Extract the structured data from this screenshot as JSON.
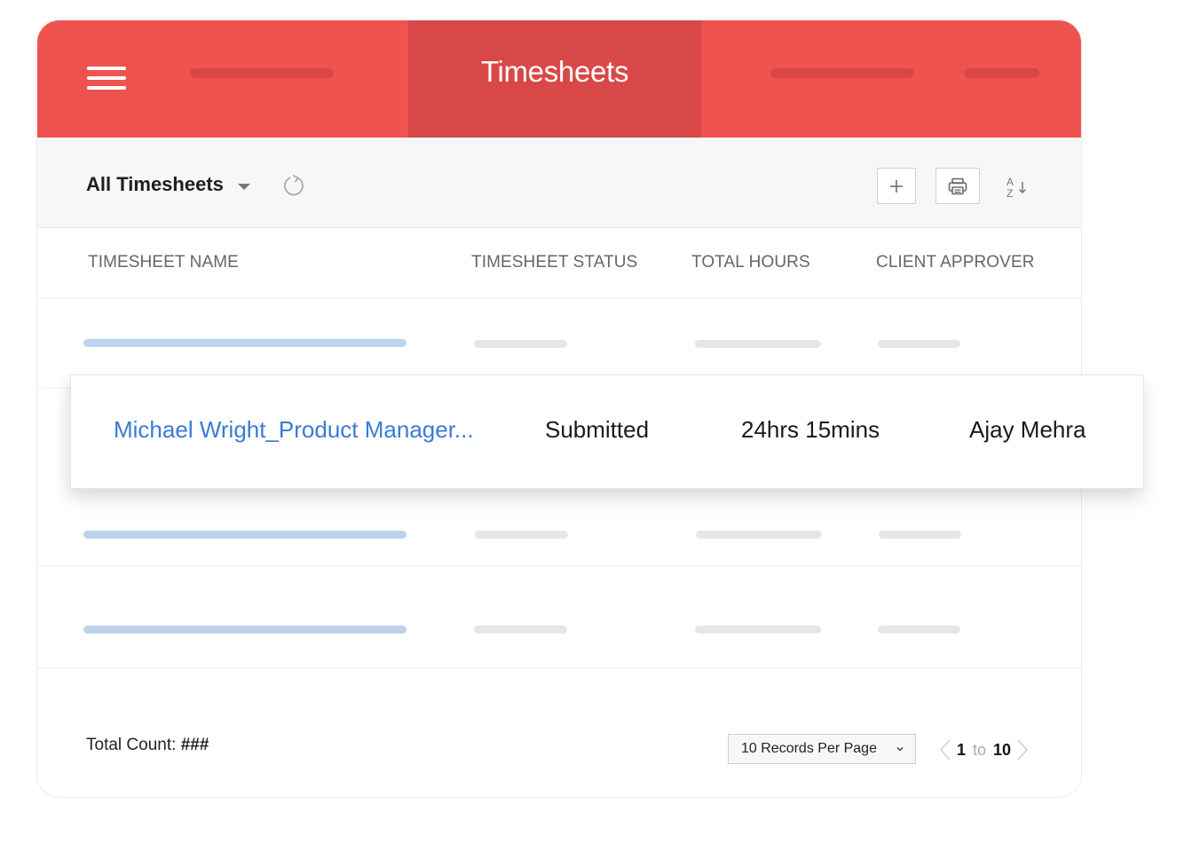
{
  "header": {
    "active_tab": "Timesheets",
    "menu_icon": "hamburger-icon",
    "brand_color": "#ef5350",
    "active_tab_color": "#d84848"
  },
  "toolbar": {
    "view_label": "All Timesheets",
    "view_caret_icon": "caret-down-icon",
    "refresh_icon": "refresh-icon",
    "add_icon": "plus-icon",
    "print_icon": "printer-icon",
    "sort_icon": "sort-az-icon"
  },
  "table": {
    "columns": [
      "TIMESHEET NAME",
      "TIMESHEET STATUS",
      "TOTAL HOURS",
      "CLIENT APPROVER"
    ],
    "highlighted_row": {
      "name": "Michael Wright_Product Manager...",
      "status": "Submitted",
      "total_hours": "24hrs 15mins",
      "client_approver": "Ajay Mehra",
      "link_color": "#3a7bd5"
    },
    "placeholder_rows": 3
  },
  "footer": {
    "total_count_label": "Total Count:",
    "total_count_value": "###",
    "per_page_value": "10 Records Per Page",
    "pager_from": "1",
    "pager_to_label": "to",
    "pager_to": "10"
  }
}
